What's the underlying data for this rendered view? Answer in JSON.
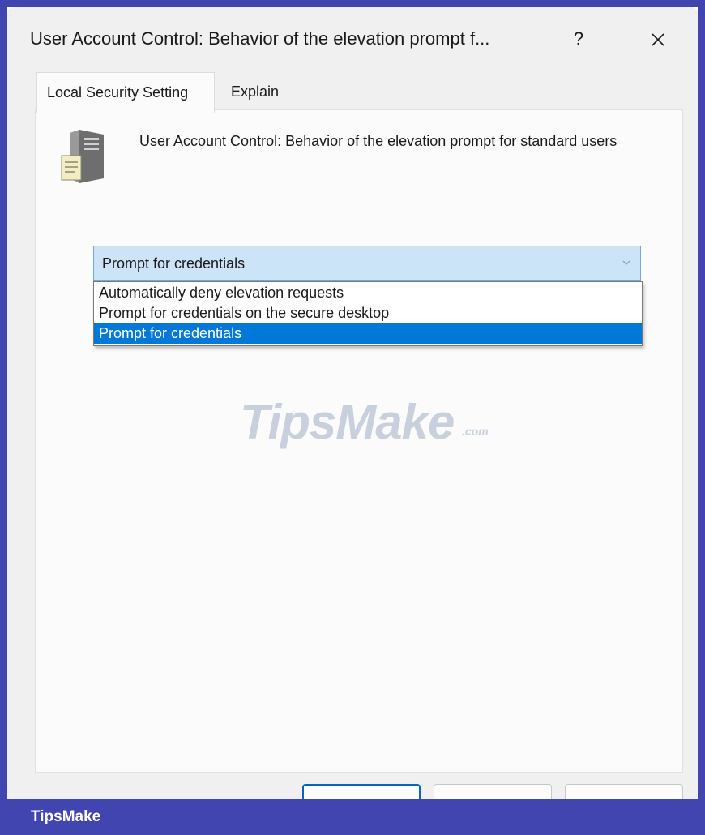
{
  "window": {
    "title": "User Account Control: Behavior of the elevation prompt f...",
    "help_label": "?"
  },
  "tabs": [
    {
      "label": "Local Security Setting",
      "active": true
    },
    {
      "label": "Explain",
      "active": false
    }
  ],
  "policy": {
    "icon": "server-document-icon",
    "title": "User Account Control: Behavior of the elevation prompt for standard users"
  },
  "dropdown": {
    "selected_value": "Prompt for credentials",
    "options": [
      {
        "label": "Automatically deny elevation requests",
        "highlighted": false
      },
      {
        "label": "Prompt for credentials on the secure desktop",
        "highlighted": false
      },
      {
        "label": "Prompt for credentials",
        "highlighted": true
      }
    ]
  },
  "watermark": {
    "text": "TipsMake",
    "suffix": ".com"
  },
  "banner": {
    "text": "TipsMake"
  },
  "colors": {
    "frame": "#4045b0",
    "selection": "#0078d7",
    "dropdown_bg": "#cce4f7"
  }
}
